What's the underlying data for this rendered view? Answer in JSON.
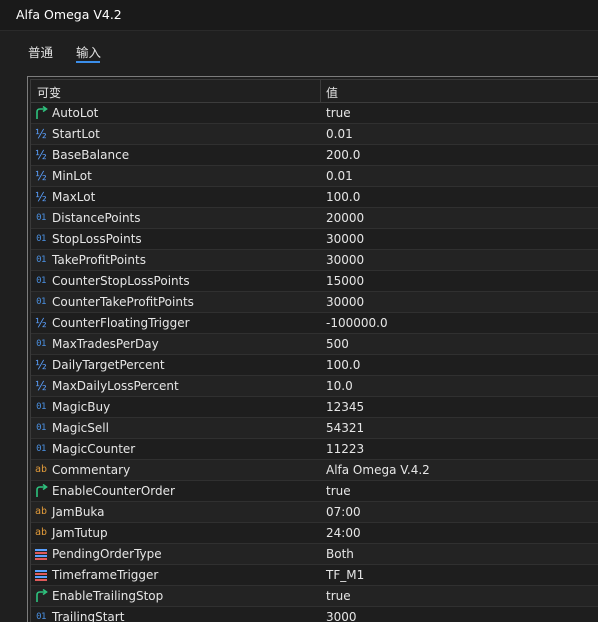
{
  "window": {
    "title": "Alfa Omega V4.2"
  },
  "tabs": [
    {
      "label": "普通"
    },
    {
      "label": "输入"
    }
  ],
  "grid": {
    "columns": {
      "variable": "可变",
      "value": "值"
    },
    "rows": [
      {
        "icon": "bool-arrow-icon",
        "name": "AutoLot",
        "value": "true"
      },
      {
        "icon": "double-icon",
        "name": "StartLot",
        "value": "0.01"
      },
      {
        "icon": "double-icon",
        "name": "BaseBalance",
        "value": "200.0"
      },
      {
        "icon": "double-icon",
        "name": "MinLot",
        "value": "0.01"
      },
      {
        "icon": "double-icon",
        "name": "MaxLot",
        "value": "100.0"
      },
      {
        "icon": "int-icon",
        "name": "DistancePoints",
        "value": "20000"
      },
      {
        "icon": "int-icon",
        "name": "StopLossPoints",
        "value": "30000"
      },
      {
        "icon": "int-icon",
        "name": "TakeProfitPoints",
        "value": "30000"
      },
      {
        "icon": "int-icon",
        "name": "CounterStopLossPoints",
        "value": "15000"
      },
      {
        "icon": "int-icon",
        "name": "CounterTakeProfitPoints",
        "value": "30000"
      },
      {
        "icon": "double-icon",
        "name": "CounterFloatingTrigger",
        "value": "-100000.0"
      },
      {
        "icon": "int-icon",
        "name": "MaxTradesPerDay",
        "value": "500"
      },
      {
        "icon": "double-icon",
        "name": "DailyTargetPercent",
        "value": "100.0"
      },
      {
        "icon": "double-icon",
        "name": "MaxDailyLossPercent",
        "value": "10.0"
      },
      {
        "icon": "int-icon",
        "name": "MagicBuy",
        "value": "12345"
      },
      {
        "icon": "int-icon",
        "name": "MagicSell",
        "value": "54321"
      },
      {
        "icon": "int-icon",
        "name": "MagicCounter",
        "value": "11223"
      },
      {
        "icon": "string-icon",
        "name": "Commentary",
        "value": "Alfa Omega V.4.2"
      },
      {
        "icon": "bool-arrow-icon",
        "name": "EnableCounterOrder",
        "value": "true"
      },
      {
        "icon": "string-icon",
        "name": "JamBuka",
        "value": "07:00"
      },
      {
        "icon": "string-icon",
        "name": "JamTutup",
        "value": "24:00"
      },
      {
        "icon": "enum-icon",
        "name": "PendingOrderType",
        "value": "Both"
      },
      {
        "icon": "enum-icon",
        "name": "TimeframeTrigger",
        "value": "TF_M1"
      },
      {
        "icon": "bool-arrow-icon",
        "name": "EnableTrailingStop",
        "value": "true"
      },
      {
        "icon": "int-icon",
        "name": "TrailingStart",
        "value": "3000"
      }
    ]
  },
  "colors": {
    "accent": "#3b8eea",
    "bool_icon": "#2ec27e",
    "double_icon": "#5aa0ff",
    "int_icon": "#4a90e2",
    "string_icon": "#e09a3a"
  }
}
